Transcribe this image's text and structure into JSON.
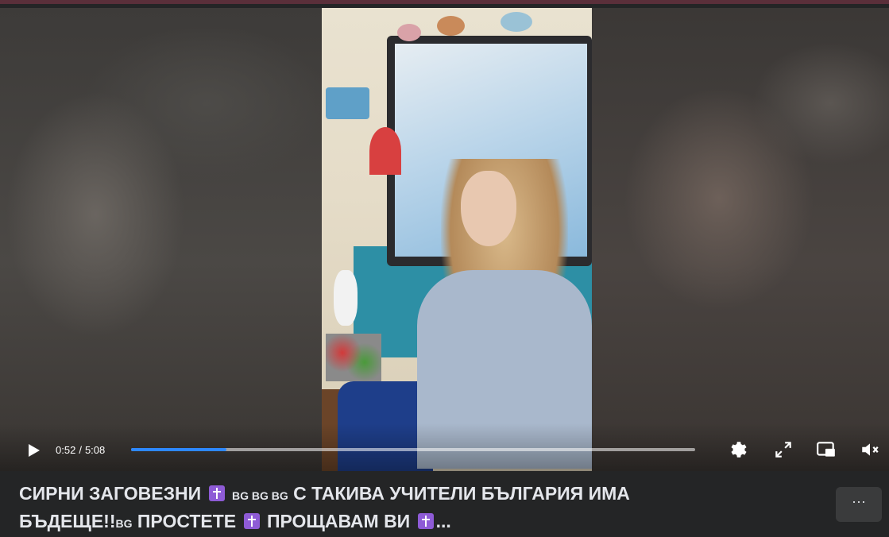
{
  "player": {
    "current_time": "0:52",
    "duration": "5:08",
    "time_separator": "/",
    "progress": 0.169,
    "controls": {
      "play_icon": "play-icon",
      "settings_icon": "gear-icon",
      "fullscreen_icon": "expand-icon",
      "pip_icon": "picture-in-picture-icon",
      "volume_icon": "volume-muted-icon"
    },
    "accent_color": "#2d88ff"
  },
  "post": {
    "title_line1_a": "СИРНИ ЗАГОВЕЗНИ",
    "flag_text": "BG BG BG",
    "title_line1_b": "С ТАКИВА УЧИТЕЛИ БЪЛГАРИЯ ИМА",
    "title_line2_a": "БЪДЕЩЕ!!",
    "flag_text_2": "BG",
    "title_line2_b": "ПРОСТЕТЕ",
    "title_line2_c": "ПРОЩАВАМ ВИ",
    "ellipsis": "...",
    "more_button": "···"
  }
}
